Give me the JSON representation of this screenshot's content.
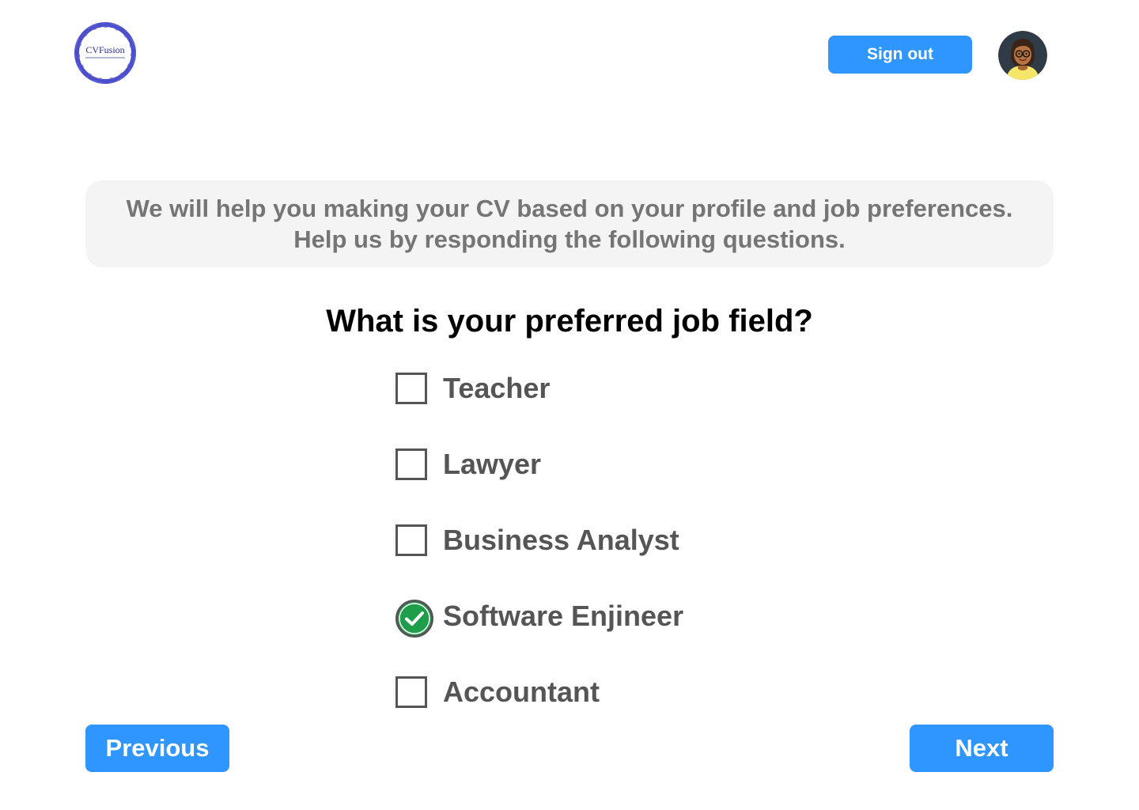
{
  "header": {
    "logo_text": "CVFusion",
    "signout_label": "Sign out"
  },
  "intro": {
    "line1": "We will help you making your CV based on your  profile and job preferences.",
    "line2": "Help us by responding the following questions."
  },
  "question": "What is your preferred job field?",
  "options": [
    {
      "label": "Teacher",
      "checked": false
    },
    {
      "label": "Lawyer",
      "checked": false
    },
    {
      "label": "Business Analyst",
      "checked": false
    },
    {
      "label": "Software Enjineer",
      "checked": true
    },
    {
      "label": "Accountant",
      "checked": false
    }
  ],
  "nav": {
    "previous_label": "Previous",
    "next_label": "Next"
  },
  "colors": {
    "primary_button": "#2f96ff",
    "intro_bg": "#f4f4f4",
    "check_green": "#1e9e4a"
  },
  "icons": {
    "logo": "cvfusion-logo-icon",
    "avatar": "avatar-icon",
    "checked": "check-circle-icon"
  }
}
